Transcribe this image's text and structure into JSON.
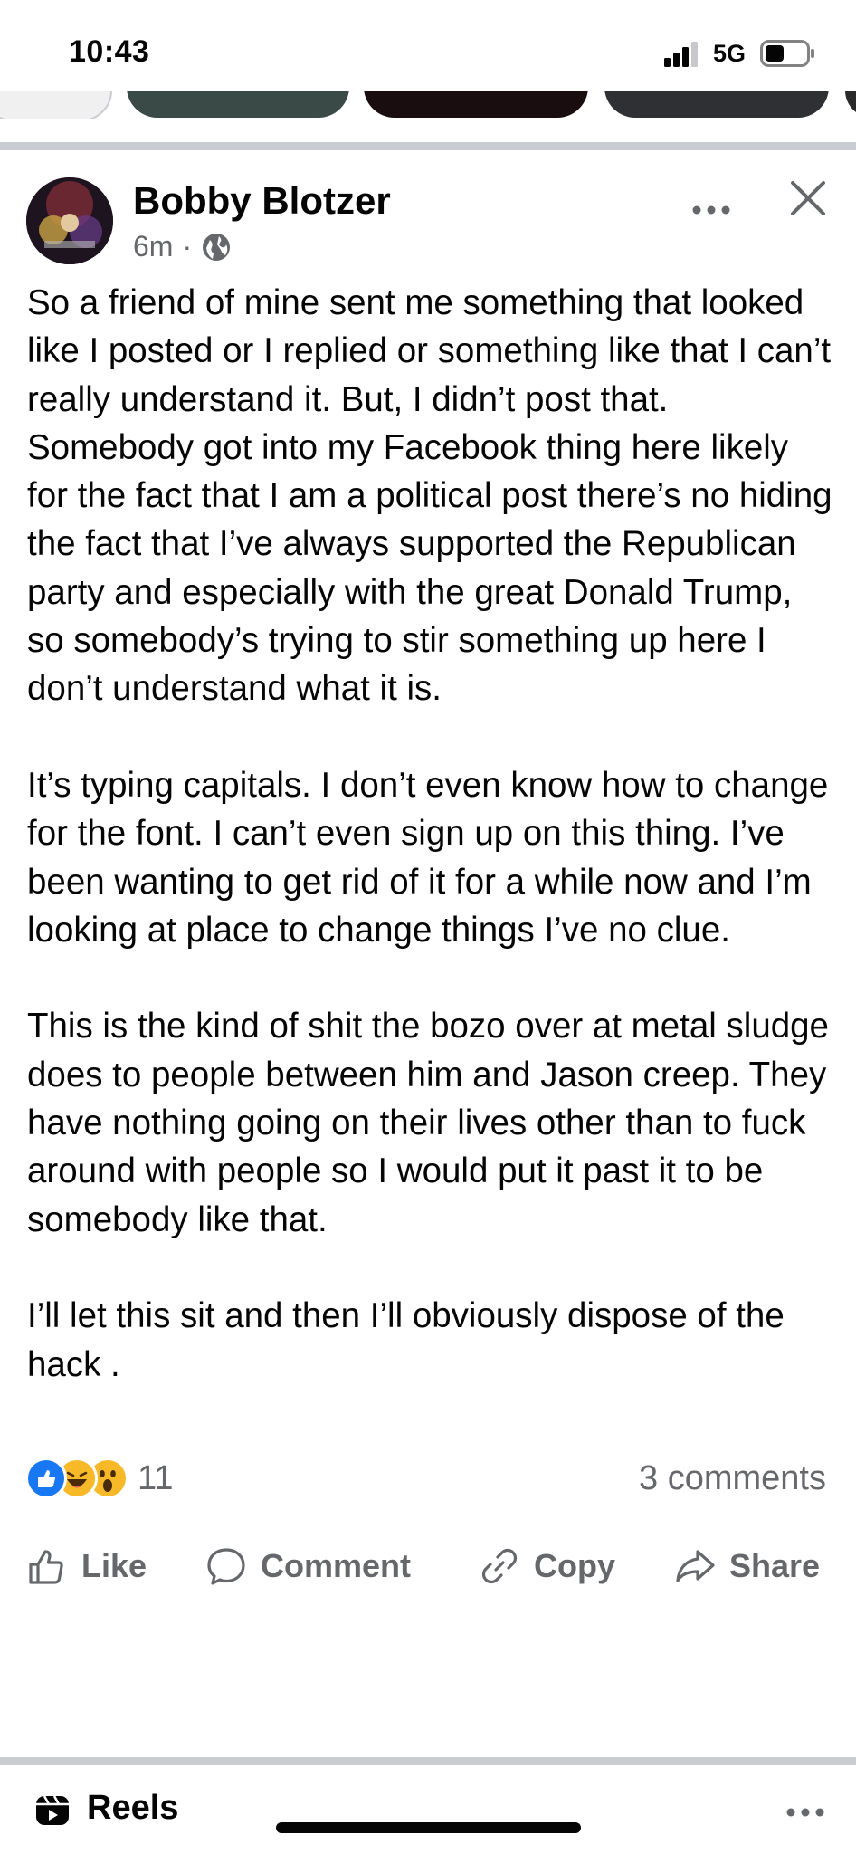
{
  "status_bar": {
    "time": "10:43",
    "network": "5G"
  },
  "post": {
    "author": "Bobby Blotzer",
    "timestamp": "6m",
    "separator": "·",
    "paragraphs": [
      "So a friend of mine sent me something that looked like I posted or I replied or something like that I can’t really understand it. But, I didn’t post that. Somebody got into my Facebook thing here likely for the fact that I am a political post there’s no hiding the fact that I’ve always supported the Republican party and especially with the great Donald Trump, so somebody’s trying to stir something up here I don’t understand what it is.",
      "It’s typing capitals. I don’t even know how to change for the font. I can’t even sign up on this thing. I’ve been wanting to get rid of it for a while now and I’m looking at place to change things I’ve no clue.",
      "This is the kind of shit the bozo over at metal sludge does to people between him and Jason creep. They have nothing going on their lives other than to fuck around with people so I would put it past it to be somebody like that.",
      "I’ll let this sit and then I’ll obviously dispose of the hack ."
    ],
    "reactions": {
      "count": "11",
      "types": [
        "like",
        "haha",
        "wow"
      ]
    },
    "comments_label": "3 comments",
    "actions": {
      "like": "Like",
      "comment": "Comment",
      "copy": "Copy",
      "share": "Share"
    }
  },
  "reels": {
    "title": "Reels"
  },
  "colors": {
    "text_primary": "#050505",
    "text_secondary": "#65676b",
    "divider": "#c9ccd1",
    "like_blue": "#1877f2",
    "emoji_yellow": "#f7b928"
  }
}
